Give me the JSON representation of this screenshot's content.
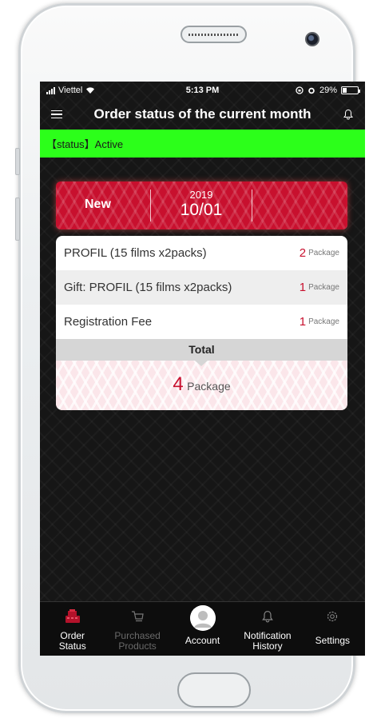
{
  "status_bar": {
    "carrier": "Viettel",
    "time": "5:13 PM",
    "battery": "29%",
    "battery_level": 0.29
  },
  "header": {
    "title": "Order status of the current month"
  },
  "status": {
    "text": "【status】Active",
    "color": "#2cff1a"
  },
  "banner": {
    "state": "New",
    "year": "2019",
    "date": "10/01",
    "color": "#c8102e"
  },
  "items": [
    {
      "name": "PROFIL (15 films x2packs)",
      "qty": "2",
      "unit": "Package"
    },
    {
      "name": "Gift: PROFIL (15 films x2packs)",
      "qty": "1",
      "unit": "Package"
    },
    {
      "name": "Registration Fee",
      "qty": "1",
      "unit": "Package"
    }
  ],
  "total": {
    "label": "Total",
    "qty": "4",
    "unit": "Package"
  },
  "tabs": [
    {
      "label1": "Order",
      "label2": "Status",
      "icon": "register-icon",
      "active": true
    },
    {
      "label1": "Purchased",
      "label2": "Products",
      "icon": "cart-icon",
      "active": false
    },
    {
      "label1": "Account",
      "label2": "",
      "icon": "avatar-icon",
      "active": false
    },
    {
      "label1": "Notification",
      "label2": "History",
      "icon": "bell-icon",
      "active": false
    },
    {
      "label1": "Settings",
      "label2": "",
      "icon": "gear-icon",
      "active": false
    }
  ]
}
